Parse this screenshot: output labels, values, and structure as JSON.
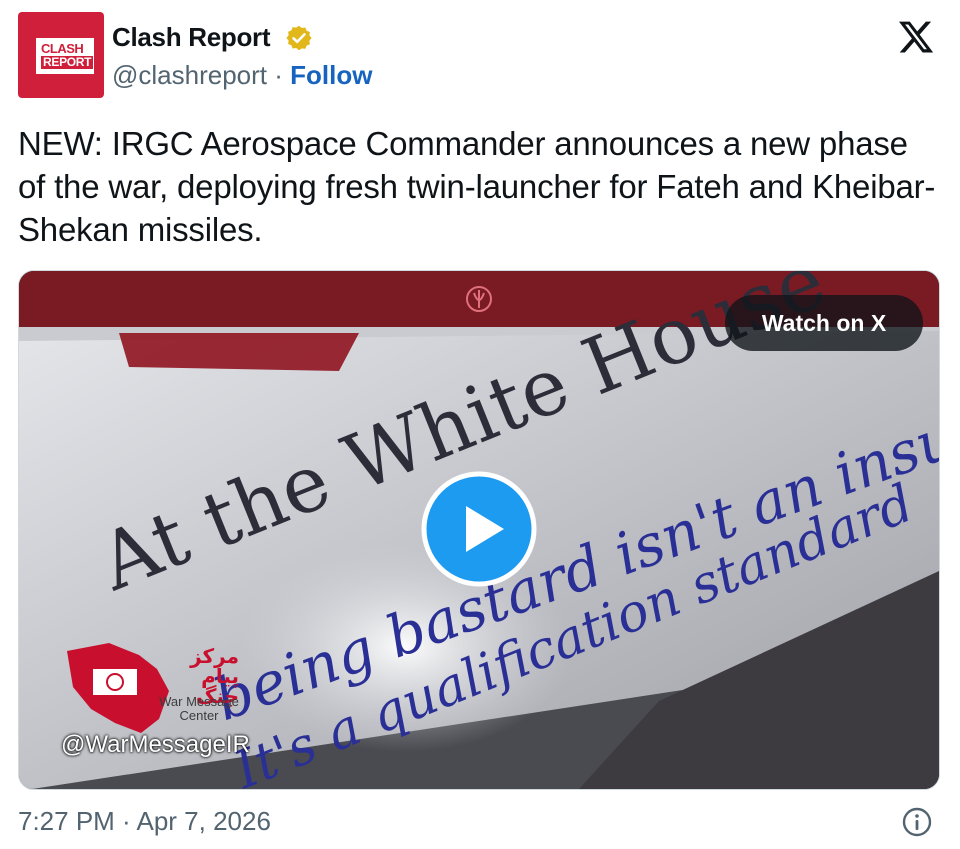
{
  "author": {
    "avatar_text_top": "CLASH",
    "avatar_text_bottom": "REPORT",
    "display_name": "Clash Report",
    "handle": "@clashreport",
    "separator": "·",
    "follow_label": "Follow",
    "verified_icon": "verified-badge-icon"
  },
  "tweet": {
    "text": "NEW: IRGC Aerospace Commander announces a new phase of the war, deploying fresh twin-launcher for Fateh and Kheibar-Shekan missiles.",
    "timestamp": "7:27 PM · Apr 7, 2026"
  },
  "media": {
    "watch_label": "Watch on X",
    "overlay_line1": "At the White House",
    "overlay_line2": "being bastard isn't an insult",
    "overlay_line3": "It's a qualification standard",
    "watermark_handle": "@WarMessageIR",
    "watermark_fa": "مرکز پیام جنگ",
    "watermark_en": "War Message Center",
    "play_icon": "play-icon"
  },
  "colors": {
    "brand_red": "#cf1f3a",
    "link_blue": "#1664c0",
    "play_blue": "#1d9bf0",
    "muted_text": "#536471"
  }
}
